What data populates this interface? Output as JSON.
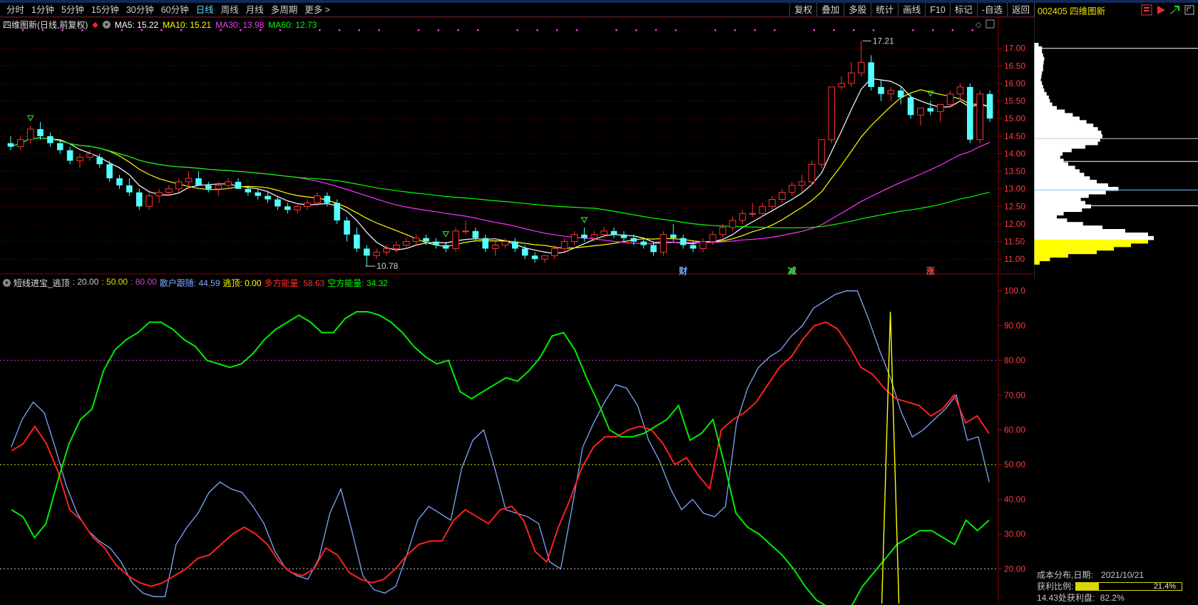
{
  "toolbar": {
    "periods": [
      "分时",
      "1分钟",
      "5分钟",
      "15分钟",
      "30分钟",
      "60分钟",
      "日线",
      "周线",
      "月线",
      "多周期",
      "更多 >"
    ],
    "active_index": 6,
    "right_buttons": [
      "复权",
      "叠加",
      "多股",
      "统计",
      "画线",
      "F10",
      "标记",
      "-自选",
      "返回"
    ]
  },
  "side": {
    "code_name": "002405 四维图新",
    "icons": [
      "menu-icon",
      "play-icon",
      "arrow-icon",
      "expand-icon"
    ]
  },
  "main_info": {
    "name": "四维图新(日线,前复权)",
    "ma": [
      {
        "label": "MA5: 15.22",
        "color": "#ffffff"
      },
      {
        "label": "MA10: 15.21",
        "color": "#ffff00"
      },
      {
        "label": "MA30: 13.98",
        "color": "#ff33ff"
      },
      {
        "label": "MA60: 12.73",
        "color": "#00ff00"
      }
    ]
  },
  "main_axis": {
    "ymin": 10.7,
    "ymax": 17.4,
    "ticks": [
      "17.00",
      "16.50",
      "16.00",
      "15.50",
      "15.00",
      "14.50",
      "14.00",
      "13.50",
      "13.00",
      "12.50",
      "12.00",
      "11.50",
      "11.00"
    ],
    "tick_values": [
      17,
      16.5,
      16,
      15.5,
      15,
      14.5,
      14,
      13.5,
      13,
      12.5,
      12,
      11.5,
      11
    ],
    "high_label": "17.21",
    "low_label": "10.78"
  },
  "event_marks": [
    {
      "label": "财",
      "color": "#6ab0ff",
      "index": 68
    },
    {
      "label": "减",
      "color": "#55dd55",
      "index": 79
    },
    {
      "label": "涨",
      "color": "#ff4444",
      "index": 93
    }
  ],
  "sub_info": {
    "name": "短线进宝_逃顶",
    "items": [
      {
        "label": ": 20.00",
        "color": "#c8c8c8"
      },
      {
        "label": ": 50.00",
        "color": "#e0e000"
      },
      {
        "label": ": 80.00",
        "color": "#cc44cc"
      },
      {
        "label": "散户跟随: 44.59",
        "color": "#7fa8ff"
      },
      {
        "label": "逃顶: 0.00",
        "color": "#ffff00"
      },
      {
        "label": "多方能量: 58.63",
        "color": "#ff3030"
      },
      {
        "label": "空方能量: 34.32",
        "color": "#00ff00"
      }
    ]
  },
  "sub_axis": {
    "ymin": 10,
    "ymax": 102,
    "ticks": [
      "100.0",
      "90.00",
      "80.00",
      "70.00",
      "60.00",
      "50.00",
      "40.00",
      "30.00",
      "20.00"
    ],
    "tick_values": [
      100,
      90,
      80,
      70,
      60,
      50,
      40,
      30,
      20
    ]
  },
  "chart_data": {
    "type": "candlestick",
    "candles": [
      [
        14.3,
        14.5,
        14.1,
        14.2
      ],
      [
        14.2,
        14.5,
        14.1,
        14.4
      ],
      [
        14.4,
        14.8,
        14.3,
        14.7
      ],
      [
        14.7,
        14.9,
        14.4,
        14.5
      ],
      [
        14.5,
        14.6,
        14.2,
        14.3
      ],
      [
        14.3,
        14.4,
        14.0,
        14.1
      ],
      [
        14.1,
        14.2,
        13.7,
        13.8
      ],
      [
        13.8,
        14.0,
        13.6,
        13.9
      ],
      [
        13.9,
        14.1,
        13.8,
        14.0
      ],
      [
        13.9,
        14.0,
        13.6,
        13.7
      ],
      [
        13.7,
        13.8,
        13.2,
        13.3
      ],
      [
        13.3,
        13.4,
        13.0,
        13.1
      ],
      [
        13.1,
        13.3,
        12.8,
        12.9
      ],
      [
        12.9,
        13.0,
        12.4,
        12.5
      ],
      [
        12.5,
        12.9,
        12.4,
        12.8
      ],
      [
        12.8,
        13.0,
        12.6,
        12.9
      ],
      [
        12.9,
        13.1,
        12.8,
        13.0
      ],
      [
        13.0,
        13.3,
        12.9,
        13.2
      ],
      [
        13.2,
        13.5,
        13.0,
        13.3
      ],
      [
        13.3,
        13.5,
        13.1,
        13.1
      ],
      [
        13.1,
        13.2,
        12.9,
        13.0
      ],
      [
        13.0,
        13.2,
        12.8,
        13.1
      ],
      [
        13.1,
        13.3,
        13.0,
        13.2
      ],
      [
        13.2,
        13.3,
        13.0,
        13.0
      ],
      [
        13.0,
        13.1,
        12.8,
        12.9
      ],
      [
        12.9,
        13.0,
        12.7,
        12.8
      ],
      [
        12.8,
        12.9,
        12.6,
        12.7
      ],
      [
        12.7,
        12.8,
        12.4,
        12.5
      ],
      [
        12.5,
        12.6,
        12.3,
        12.4
      ],
      [
        12.4,
        12.6,
        12.3,
        12.5
      ],
      [
        12.5,
        12.7,
        12.4,
        12.6
      ],
      [
        12.6,
        12.9,
        12.5,
        12.8
      ],
      [
        12.8,
        12.9,
        12.5,
        12.6
      ],
      [
        12.6,
        12.7,
        12.0,
        12.1
      ],
      [
        12.1,
        12.2,
        11.5,
        11.7
      ],
      [
        11.7,
        11.9,
        11.2,
        11.3
      ],
      [
        11.3,
        11.4,
        10.8,
        11.1
      ],
      [
        11.1,
        11.3,
        11.0,
        11.2
      ],
      [
        11.2,
        11.4,
        11.1,
        11.3
      ],
      [
        11.3,
        11.5,
        11.2,
        11.4
      ],
      [
        11.4,
        11.6,
        11.3,
        11.5
      ],
      [
        11.5,
        11.7,
        11.4,
        11.6
      ],
      [
        11.6,
        11.7,
        11.4,
        11.5
      ],
      [
        11.5,
        11.6,
        11.3,
        11.4
      ],
      [
        11.4,
        11.5,
        11.2,
        11.3
      ],
      [
        11.3,
        11.9,
        11.2,
        11.8
      ],
      [
        11.8,
        12.1,
        11.7,
        11.8
      ],
      [
        11.8,
        11.9,
        11.5,
        11.6
      ],
      [
        11.6,
        11.7,
        11.2,
        11.3
      ],
      [
        11.3,
        11.5,
        11.1,
        11.4
      ],
      [
        11.4,
        11.6,
        11.3,
        11.5
      ],
      [
        11.5,
        11.6,
        11.2,
        11.3
      ],
      [
        11.3,
        11.4,
        11.0,
        11.1
      ],
      [
        11.1,
        11.2,
        10.9,
        11.0
      ],
      [
        11.0,
        11.1,
        10.9,
        11.1
      ],
      [
        11.1,
        11.4,
        11.0,
        11.3
      ],
      [
        11.3,
        11.6,
        11.2,
        11.5
      ],
      [
        11.5,
        11.8,
        11.4,
        11.7
      ],
      [
        11.7,
        11.9,
        11.5,
        11.6
      ],
      [
        11.6,
        11.8,
        11.5,
        11.7
      ],
      [
        11.7,
        11.9,
        11.6,
        11.8
      ],
      [
        11.8,
        11.9,
        11.6,
        11.7
      ],
      [
        11.7,
        11.8,
        11.5,
        11.6
      ],
      [
        11.6,
        11.7,
        11.4,
        11.5
      ],
      [
        11.5,
        11.6,
        11.3,
        11.4
      ],
      [
        11.4,
        11.5,
        11.1,
        11.2
      ],
      [
        11.2,
        11.8,
        11.1,
        11.7
      ],
      [
        11.7,
        12.0,
        11.5,
        11.6
      ],
      [
        11.6,
        11.7,
        11.3,
        11.4
      ],
      [
        11.4,
        11.5,
        11.2,
        11.3
      ],
      [
        11.3,
        11.6,
        11.2,
        11.5
      ],
      [
        11.5,
        11.8,
        11.4,
        11.7
      ],
      [
        11.7,
        12.0,
        11.6,
        11.9
      ],
      [
        11.9,
        12.2,
        11.8,
        12.1
      ],
      [
        12.1,
        12.4,
        12.0,
        12.3
      ],
      [
        12.3,
        12.6,
        12.2,
        12.3
      ],
      [
        12.3,
        12.6,
        12.2,
        12.5
      ],
      [
        12.5,
        12.8,
        12.4,
        12.7
      ],
      [
        12.7,
        13.0,
        12.6,
        12.9
      ],
      [
        12.9,
        13.2,
        12.8,
        13.1
      ],
      [
        13.1,
        13.4,
        12.9,
        13.2
      ],
      [
        13.2,
        13.8,
        13.1,
        13.7
      ],
      [
        13.7,
        14.4,
        13.6,
        14.4
      ],
      [
        14.4,
        15.9,
        14.3,
        15.9
      ],
      [
        15.9,
        16.2,
        15.8,
        16.0
      ],
      [
        16.0,
        16.6,
        15.9,
        16.3
      ],
      [
        16.3,
        17.21,
        16.2,
        16.6
      ],
      [
        16.6,
        16.8,
        15.8,
        15.9
      ],
      [
        15.9,
        16.1,
        15.5,
        15.7
      ],
      [
        15.7,
        15.9,
        15.5,
        15.8
      ],
      [
        15.8,
        15.9,
        15.4,
        15.6
      ],
      [
        15.6,
        15.7,
        15.0,
        15.1
      ],
      [
        15.1,
        15.3,
        14.8,
        15.3
      ],
      [
        15.3,
        15.5,
        15.1,
        15.2
      ],
      [
        15.2,
        15.4,
        14.9,
        15.4
      ],
      [
        15.4,
        15.8,
        15.3,
        15.7
      ],
      [
        15.7,
        16.0,
        15.5,
        15.9
      ],
      [
        15.9,
        16.0,
        14.3,
        14.4
      ],
      [
        14.4,
        15.8,
        14.3,
        15.7
      ],
      [
        15.7,
        15.8,
        14.9,
        15.0
      ]
    ],
    "ma_series": [
      {
        "name": "MA5",
        "color": "#ffffff"
      },
      {
        "name": "MA10",
        "color": "#ffff00"
      },
      {
        "name": "MA30",
        "color": "#ff33ff"
      },
      {
        "name": "MA60",
        "color": "#00ff00"
      }
    ],
    "indicator": {
      "series": [
        {
          "name": "散户跟随",
          "color": "#7fa8ff",
          "values": [
            55,
            63,
            68,
            65,
            55,
            44,
            36,
            31,
            28,
            26,
            22,
            16,
            13,
            12,
            12,
            27,
            32,
            36,
            42,
            45,
            43,
            42,
            38,
            33,
            25,
            20,
            18,
            17,
            23,
            36,
            43,
            31,
            18,
            14,
            13,
            15,
            24,
            34,
            38,
            36,
            34,
            49,
            57,
            60,
            49,
            37,
            36,
            35,
            33,
            22,
            20,
            37,
            55,
            62,
            68,
            73,
            72,
            67,
            57,
            51,
            43,
            37,
            40,
            36,
            35,
            38,
            62,
            72,
            78,
            81,
            83,
            87,
            90,
            95,
            97,
            99,
            100,
            100,
            92,
            83,
            75,
            65,
            58,
            60,
            63,
            66,
            70,
            57,
            58,
            45
          ]
        },
        {
          "name": "多方能量",
          "color": "#ff2020",
          "values": [
            54,
            56,
            61,
            56,
            48,
            37,
            34,
            29,
            26,
            21,
            18,
            16,
            15,
            16,
            18,
            20,
            23,
            24,
            27,
            30,
            32,
            30,
            27,
            22,
            19,
            18,
            20,
            26,
            24,
            19,
            17,
            16,
            17,
            20,
            24,
            27,
            28,
            28,
            34,
            37,
            35,
            33,
            37,
            38,
            34,
            25,
            22,
            32,
            40,
            49,
            55,
            58,
            58,
            60,
            61,
            60,
            56,
            50,
            52,
            47,
            43,
            60,
            63,
            65,
            68,
            73,
            78,
            81,
            86,
            90,
            91,
            89,
            84,
            78,
            76,
            72,
            69,
            68,
            67,
            64,
            66,
            70,
            62,
            64,
            59
          ]
        },
        {
          "name": "空方能量",
          "color": "#00ee00",
          "values": [
            37,
            35,
            29,
            33,
            45,
            56,
            63,
            66,
            77,
            83,
            86,
            88,
            91,
            91,
            89,
            86,
            84,
            80,
            79,
            78,
            79,
            82,
            86,
            89,
            91,
            93,
            91,
            88,
            88,
            92,
            94,
            94,
            93,
            91,
            88,
            84,
            81,
            79,
            80,
            71,
            69,
            71,
            73,
            75,
            74,
            77,
            81,
            87,
            88,
            83,
            75,
            68,
            60,
            58,
            58,
            59,
            61,
            63,
            67,
            57,
            59,
            63,
            50,
            36,
            32,
            30,
            27,
            24,
            20,
            15,
            11,
            9,
            8,
            9,
            15,
            19,
            23,
            27,
            29,
            31,
            31,
            29,
            27,
            34,
            31,
            34
          ]
        },
        {
          "name": "逃顶",
          "color": "#ffff00",
          "values": []
        }
      ],
      "levels": [
        {
          "value": 80,
          "color": "#cc44cc"
        },
        {
          "value": 50,
          "color": "#e0e000"
        },
        {
          "value": 20,
          "color": "#c8c8c8"
        }
      ],
      "spike_index": 80
    },
    "cost_distribution": {
      "date_label": "成本分布,日期:",
      "date": "2021/10/21",
      "profit_label": "获利比例:",
      "profit_value": "21.4%",
      "profit_ratio": 0.214,
      "note_label": "14.43处获利盘:",
      "note_value": "82.2%",
      "profile": [
        [
          17.1,
          8
        ],
        [
          17.0,
          14
        ],
        [
          16.9,
          14
        ],
        [
          16.8,
          16
        ],
        [
          16.7,
          18
        ],
        [
          16.6,
          17
        ],
        [
          16.5,
          16
        ],
        [
          16.4,
          16
        ],
        [
          16.3,
          14
        ],
        [
          16.2,
          13
        ],
        [
          16.1,
          12
        ],
        [
          16.0,
          14
        ],
        [
          15.9,
          16
        ],
        [
          15.8,
          18
        ],
        [
          15.7,
          22
        ],
        [
          15.6,
          26
        ],
        [
          15.5,
          28
        ],
        [
          15.4,
          32
        ],
        [
          15.3,
          40
        ],
        [
          15.2,
          54
        ],
        [
          15.1,
          68
        ],
        [
          15.0,
          80
        ],
        [
          14.9,
          92
        ],
        [
          14.8,
          104
        ],
        [
          14.7,
          112
        ],
        [
          14.6,
          118
        ],
        [
          14.5,
          120
        ],
        [
          14.4,
          116
        ],
        [
          14.3,
          112
        ],
        [
          14.2,
          90
        ],
        [
          14.1,
          66
        ],
        [
          14.0,
          50
        ],
        [
          13.9,
          46
        ],
        [
          13.8,
          52
        ],
        [
          13.7,
          60
        ],
        [
          13.6,
          72
        ],
        [
          13.5,
          80
        ],
        [
          13.4,
          88
        ],
        [
          13.3,
          98
        ],
        [
          13.2,
          110
        ],
        [
          13.1,
          130
        ],
        [
          13.0,
          148
        ],
        [
          12.9,
          126
        ],
        [
          12.8,
          96
        ],
        [
          12.7,
          82
        ],
        [
          12.6,
          90
        ],
        [
          12.5,
          100
        ],
        [
          12.4,
          84
        ],
        [
          12.3,
          52
        ],
        [
          12.2,
          40
        ],
        [
          12.1,
          58
        ],
        [
          12.0,
          86
        ],
        [
          11.9,
          120
        ],
        [
          11.8,
          160
        ],
        [
          11.7,
          200
        ],
        [
          11.6,
          210
        ],
        [
          11.5,
          200
        ],
        [
          11.4,
          170
        ],
        [
          11.3,
          140
        ],
        [
          11.2,
          110
        ],
        [
          11.1,
          60
        ],
        [
          11.0,
          28
        ],
        [
          10.9,
          10
        ]
      ]
    }
  }
}
